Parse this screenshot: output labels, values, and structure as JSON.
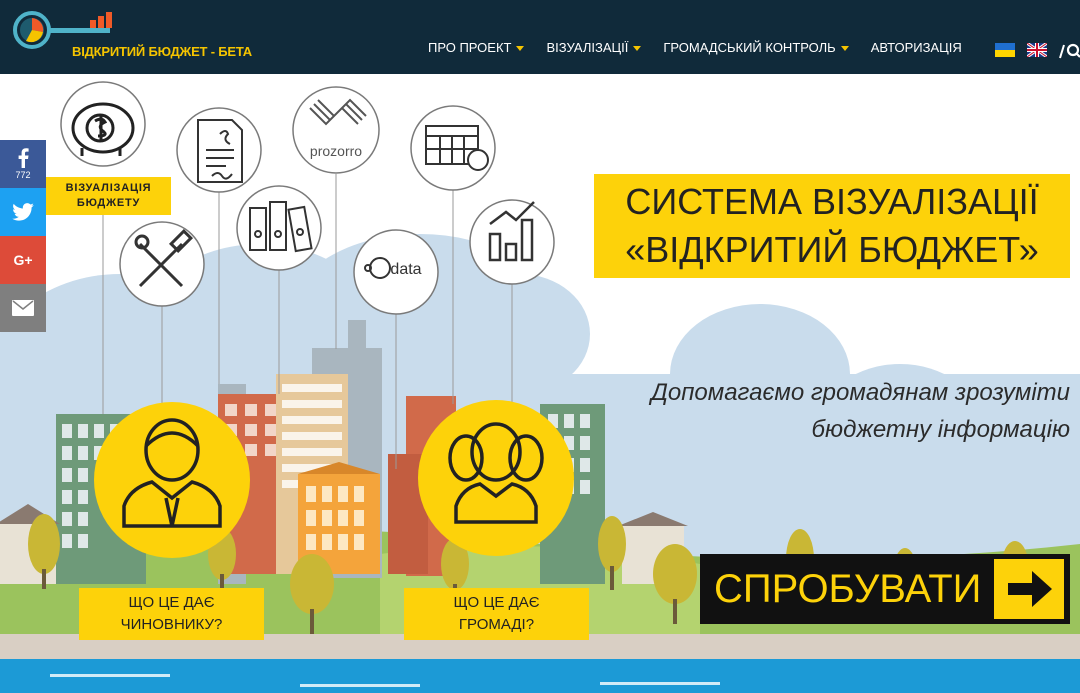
{
  "header": {
    "logo_text": "ВІДКРИТИЙ БЮДЖЕТ - БЕТА",
    "nav": [
      {
        "label": "ПРО ПРОЕКТ",
        "dropdown": true
      },
      {
        "label": "ВІЗУАЛІЗАЦІЇ",
        "dropdown": true
      },
      {
        "label": "ГРОМАДСЬКИЙ КОНТРОЛЬ",
        "dropdown": true
      },
      {
        "label": "АВТОРИЗАЦІЯ",
        "dropdown": false
      }
    ],
    "languages": [
      "ua-flag-icon",
      "uk-flag-icon"
    ],
    "search_icon": "search-icon"
  },
  "hero": {
    "title_line1": "СИСТЕМА ВІЗУАЛІЗАЦІЇ",
    "title_line2": "«ВІДКРИТИЙ БЮДЖЕТ»",
    "subtitle_line1": "Допомагаємо громадянам зрозуміти",
    "subtitle_line2": "бюджетну інформацію",
    "cta_label": "СПРОБУВАТИ",
    "viz_label_line1": "ВІЗУАЛІЗАЦІЯ",
    "viz_label_line2": "БЮДЖЕТУ",
    "officials_line1": "ЩО ЦЕ ДАЄ",
    "officials_line2": "ЧИНОВНИКУ?",
    "community_line1": "ЩО ЦЕ ДАЄ",
    "community_line2": "ГРОМАДІ?",
    "prozorro_text": "prozorro",
    "edata_text": "data"
  },
  "social": {
    "facebook_count": "772",
    "icons": [
      "facebook-icon",
      "twitter-icon",
      "google-plus-icon",
      "email-icon"
    ],
    "gplus_text": "G+"
  },
  "colors": {
    "header_bg": "#102a3a",
    "accent_yellow": "#fdd20a",
    "logo_yellow": "#f5c400",
    "sky": "#c9dcec",
    "facebook": "#3b5998",
    "twitter": "#1da1f2",
    "google_plus": "#dd4b39",
    "email": "#7f7f7f"
  }
}
